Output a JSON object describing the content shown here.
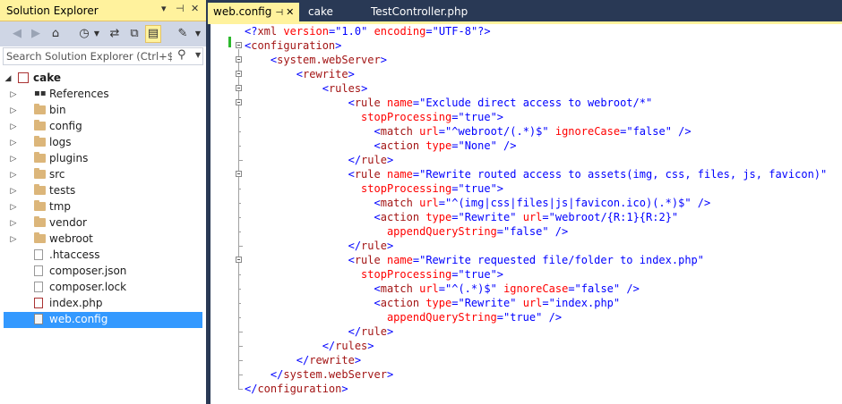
{
  "solution_explorer": {
    "title": "Solution Explorer",
    "title_controls": [
      "▾",
      "📌",
      "✕"
    ],
    "search_placeholder": "Search Solution Explorer (Ctrl+$)",
    "tree": [
      {
        "label": "cake",
        "type": "project",
        "bold": true,
        "expanded": true
      },
      {
        "label": "References",
        "type": "references",
        "expanded": false
      },
      {
        "label": "bin",
        "type": "folder",
        "expanded": false
      },
      {
        "label": "config",
        "type": "folder",
        "expanded": false
      },
      {
        "label": "logs",
        "type": "folder",
        "expanded": false
      },
      {
        "label": "plugins",
        "type": "folder",
        "expanded": false
      },
      {
        "label": "src",
        "type": "folder",
        "expanded": false
      },
      {
        "label": "tests",
        "type": "folder",
        "expanded": false
      },
      {
        "label": "tmp",
        "type": "folder",
        "expanded": false
      },
      {
        "label": "vendor",
        "type": "folder",
        "expanded": false
      },
      {
        "label": "webroot",
        "type": "folder",
        "expanded": false
      },
      {
        "label": ".htaccess",
        "type": "file"
      },
      {
        "label": "composer.json",
        "type": "file"
      },
      {
        "label": "composer.lock",
        "type": "file"
      },
      {
        "label": "index.php",
        "type": "php"
      },
      {
        "label": "web.config",
        "type": "config",
        "selected": true
      }
    ]
  },
  "editor_tabs": [
    {
      "label": "web.config",
      "active": true,
      "pin": "⊣",
      "close": "✕"
    },
    {
      "label": "cake",
      "active": false
    },
    {
      "label": "TestController.php",
      "active": false
    }
  ],
  "code_lines": [
    [
      [
        "b",
        "<?"
      ],
      [
        "e",
        "xml"
      ],
      [
        "k",
        " "
      ],
      [
        "a",
        "version"
      ],
      [
        "b",
        "=\""
      ],
      [
        "v",
        "1.0"
      ],
      [
        "b",
        "\""
      ],
      [
        "k",
        " "
      ],
      [
        "a",
        "encoding"
      ],
      [
        "b",
        "=\""
      ],
      [
        "v",
        "UTF-8"
      ],
      [
        "b",
        "\"?>"
      ]
    ],
    [
      [
        "b",
        "<"
      ],
      [
        "e",
        "configuration"
      ],
      [
        "b",
        ">"
      ]
    ],
    [
      [
        "k",
        "    "
      ],
      [
        "b",
        "<"
      ],
      [
        "e",
        "system.webServer"
      ],
      [
        "b",
        ">"
      ]
    ],
    [
      [
        "k",
        "        "
      ],
      [
        "b",
        "<"
      ],
      [
        "e",
        "rewrite"
      ],
      [
        "b",
        ">"
      ]
    ],
    [
      [
        "k",
        "            "
      ],
      [
        "b",
        "<"
      ],
      [
        "e",
        "rules"
      ],
      [
        "b",
        ">"
      ]
    ],
    [
      [
        "k",
        "                "
      ],
      [
        "b",
        "<"
      ],
      [
        "e",
        "rule"
      ],
      [
        "k",
        " "
      ],
      [
        "a",
        "name"
      ],
      [
        "b",
        "=\""
      ],
      [
        "v",
        "Exclude direct access to webroot/*"
      ],
      [
        "b",
        "\""
      ]
    ],
    [
      [
        "k",
        "                  "
      ],
      [
        "a",
        "stopProcessing"
      ],
      [
        "b",
        "=\""
      ],
      [
        "v",
        "true"
      ],
      [
        "b",
        "\">"
      ]
    ],
    [
      [
        "k",
        "                    "
      ],
      [
        "b",
        "<"
      ],
      [
        "e",
        "match"
      ],
      [
        "k",
        " "
      ],
      [
        "a",
        "url"
      ],
      [
        "b",
        "=\""
      ],
      [
        "v",
        "^webroot/(.*)$"
      ],
      [
        "b",
        "\""
      ],
      [
        "k",
        " "
      ],
      [
        "a",
        "ignoreCase"
      ],
      [
        "b",
        "=\""
      ],
      [
        "v",
        "false"
      ],
      [
        "b",
        "\" />"
      ]
    ],
    [
      [
        "k",
        "                    "
      ],
      [
        "b",
        "<"
      ],
      [
        "e",
        "action"
      ],
      [
        "k",
        " "
      ],
      [
        "a",
        "type"
      ],
      [
        "b",
        "=\""
      ],
      [
        "v",
        "None"
      ],
      [
        "b",
        "\" />"
      ]
    ],
    [
      [
        "k",
        "                "
      ],
      [
        "b",
        "</"
      ],
      [
        "e",
        "rule"
      ],
      [
        "b",
        ">"
      ]
    ],
    [
      [
        "k",
        "                "
      ],
      [
        "b",
        "<"
      ],
      [
        "e",
        "rule"
      ],
      [
        "k",
        " "
      ],
      [
        "a",
        "name"
      ],
      [
        "b",
        "=\""
      ],
      [
        "v",
        "Rewrite routed access to assets(img, css, files, js, favicon)"
      ],
      [
        "b",
        "\""
      ]
    ],
    [
      [
        "k",
        "                  "
      ],
      [
        "a",
        "stopProcessing"
      ],
      [
        "b",
        "=\""
      ],
      [
        "v",
        "true"
      ],
      [
        "b",
        "\">"
      ]
    ],
    [
      [
        "k",
        "                    "
      ],
      [
        "b",
        "<"
      ],
      [
        "e",
        "match"
      ],
      [
        "k",
        " "
      ],
      [
        "a",
        "url"
      ],
      [
        "b",
        "=\""
      ],
      [
        "v",
        "^(img|css|files|js|favicon.ico)(.*)$"
      ],
      [
        "b",
        "\" />"
      ]
    ],
    [
      [
        "k",
        "                    "
      ],
      [
        "b",
        "<"
      ],
      [
        "e",
        "action"
      ],
      [
        "k",
        " "
      ],
      [
        "a",
        "type"
      ],
      [
        "b",
        "=\""
      ],
      [
        "v",
        "Rewrite"
      ],
      [
        "b",
        "\""
      ],
      [
        "k",
        " "
      ],
      [
        "a",
        "url"
      ],
      [
        "b",
        "=\""
      ],
      [
        "v",
        "webroot/{R:1}{R:2}"
      ],
      [
        "b",
        "\""
      ]
    ],
    [
      [
        "k",
        "                      "
      ],
      [
        "a",
        "appendQueryString"
      ],
      [
        "b",
        "=\""
      ],
      [
        "v",
        "false"
      ],
      [
        "b",
        "\" />"
      ]
    ],
    [
      [
        "k",
        "                "
      ],
      [
        "b",
        "</"
      ],
      [
        "e",
        "rule"
      ],
      [
        "b",
        ">"
      ]
    ],
    [
      [
        "k",
        "                "
      ],
      [
        "b",
        "<"
      ],
      [
        "e",
        "rule"
      ],
      [
        "k",
        " "
      ],
      [
        "a",
        "name"
      ],
      [
        "b",
        "=\""
      ],
      [
        "v",
        "Rewrite requested file/folder to index.php"
      ],
      [
        "b",
        "\""
      ]
    ],
    [
      [
        "k",
        "                  "
      ],
      [
        "a",
        "stopProcessing"
      ],
      [
        "b",
        "=\""
      ],
      [
        "v",
        "true"
      ],
      [
        "b",
        "\">"
      ]
    ],
    [
      [
        "k",
        "                    "
      ],
      [
        "b",
        "<"
      ],
      [
        "e",
        "match"
      ],
      [
        "k",
        " "
      ],
      [
        "a",
        "url"
      ],
      [
        "b",
        "=\""
      ],
      [
        "v",
        "^(.*)$"
      ],
      [
        "b",
        "\""
      ],
      [
        "k",
        " "
      ],
      [
        "a",
        "ignoreCase"
      ],
      [
        "b",
        "=\""
      ],
      [
        "v",
        "false"
      ],
      [
        "b",
        "\" />"
      ]
    ],
    [
      [
        "k",
        "                    "
      ],
      [
        "b",
        "<"
      ],
      [
        "e",
        "action"
      ],
      [
        "k",
        " "
      ],
      [
        "a",
        "type"
      ],
      [
        "b",
        "=\""
      ],
      [
        "v",
        "Rewrite"
      ],
      [
        "b",
        "\""
      ],
      [
        "k",
        " "
      ],
      [
        "a",
        "url"
      ],
      [
        "b",
        "=\""
      ],
      [
        "v",
        "index.php"
      ],
      [
        "b",
        "\""
      ]
    ],
    [
      [
        "k",
        "                      "
      ],
      [
        "a",
        "appendQueryString"
      ],
      [
        "b",
        "=\""
      ],
      [
        "v",
        "true"
      ],
      [
        "b",
        "\" />"
      ]
    ],
    [
      [
        "k",
        "                "
      ],
      [
        "b",
        "</"
      ],
      [
        "e",
        "rule"
      ],
      [
        "b",
        ">"
      ]
    ],
    [
      [
        "k",
        "            "
      ],
      [
        "b",
        "</"
      ],
      [
        "e",
        "rules"
      ],
      [
        "b",
        ">"
      ]
    ],
    [
      [
        "k",
        "        "
      ],
      [
        "b",
        "</"
      ],
      [
        "e",
        "rewrite"
      ],
      [
        "b",
        ">"
      ]
    ],
    [
      [
        "k",
        "    "
      ],
      [
        "b",
        "</"
      ],
      [
        "e",
        "system.webServer"
      ],
      [
        "b",
        ">"
      ]
    ],
    [
      [
        "b",
        "</"
      ],
      [
        "e",
        "configuration"
      ],
      [
        "b",
        ">"
      ]
    ]
  ],
  "colors": {
    "chrome": "#293955",
    "active_tab": "#fff29d",
    "selection": "#3399ff",
    "xml_delimiter": "#0000ff",
    "xml_element": "#a31515",
    "xml_attribute": "#ff0000",
    "xml_value": "#0000ff"
  }
}
